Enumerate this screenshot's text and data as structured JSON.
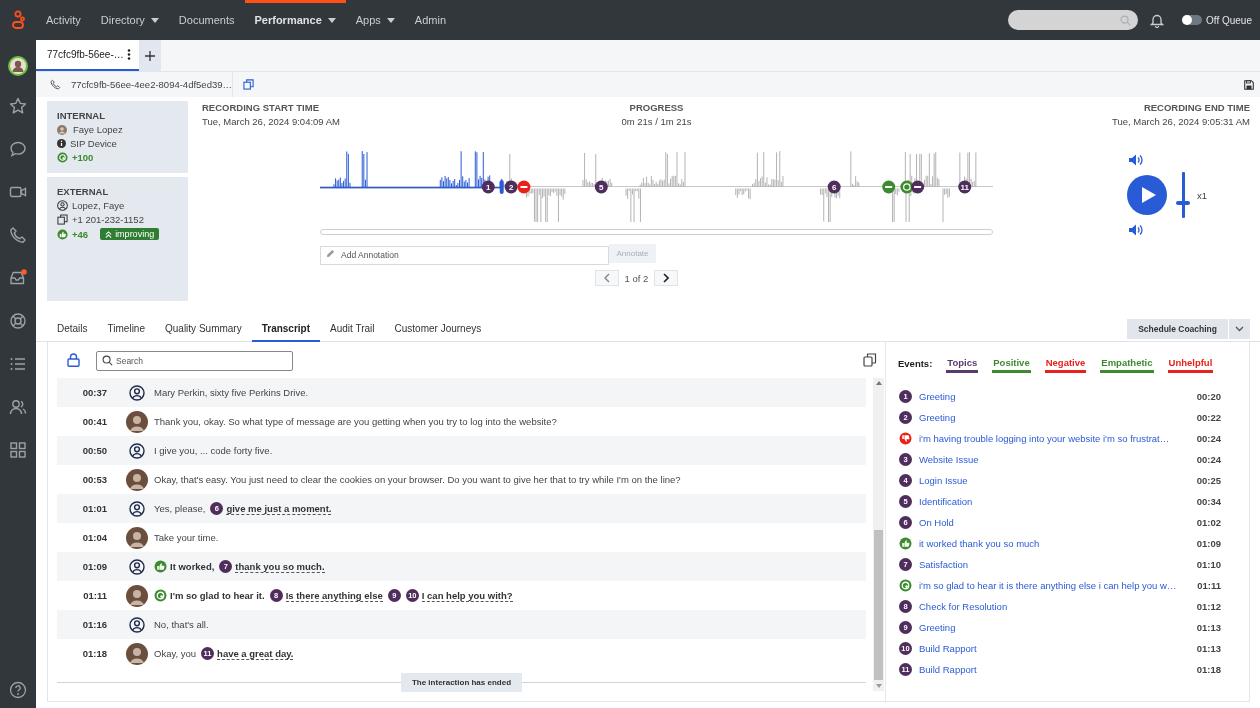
{
  "nav": {
    "items": [
      {
        "label": "Activity",
        "dropdown": false,
        "selected": false
      },
      {
        "label": "Directory",
        "dropdown": true,
        "selected": false
      },
      {
        "label": "Documents",
        "dropdown": false,
        "selected": false
      },
      {
        "label": "Performance",
        "dropdown": true,
        "selected": true
      },
      {
        "label": "Apps",
        "dropdown": true,
        "selected": false
      },
      {
        "label": "Admin",
        "dropdown": false,
        "selected": false
      }
    ],
    "queue": {
      "label": "Off Queue",
      "on": false
    }
  },
  "doc_tabs": [
    {
      "label": "77cfc9fb-56ee-…",
      "selected": true
    }
  ],
  "interaction_id": "77cfc9fb-56ee-4ee2-8094-4df5ed39…",
  "participants": [
    {
      "kind": "internal",
      "heading": "INTERNAL",
      "name": "Faye Lopez",
      "device": "SIP Device",
      "score": "+100"
    },
    {
      "kind": "external",
      "heading": "EXTERNAL",
      "name": "Lopez, Faye",
      "phone": "+1 201-232-1152",
      "score": "+46",
      "trend": "improving"
    }
  ],
  "recording": {
    "start_label": "RECORDING START TIME",
    "start_time": "Tue, March 26, 2024 9:04:09 AM",
    "progress_label": "PROGRESS",
    "progress": "0m 21s / 1m 21s",
    "end_label": "RECORDING END TIME",
    "end_time": "Tue, March 26, 2024 9:05:31 AM",
    "playback": {
      "level": 0.27
    },
    "markers": [
      {
        "kind": "topic",
        "label": "1"
      },
      {
        "kind": "topic",
        "label": "2"
      },
      {
        "kind": "negative"
      },
      {
        "kind": "topic",
        "label": "5"
      },
      {
        "kind": "topic",
        "label": "6"
      },
      {
        "kind": "positive"
      },
      {
        "kind": "empathetic"
      },
      {
        "kind": "group"
      },
      {
        "kind": "topic",
        "label": "11"
      }
    ],
    "volume": {
      "level": 0.35
    },
    "speed": "x1",
    "annotation": {
      "placeholder": "Add Annotation"
    },
    "annotate_button": {
      "label": "Annotate",
      "disabled": true
    },
    "pager": "1 of 2"
  },
  "detail_tabs": [
    {
      "label": "Details",
      "selected": false
    },
    {
      "label": "Timeline",
      "selected": false
    },
    {
      "label": "Quality Summary",
      "selected": false
    },
    {
      "label": "Transcript",
      "selected": true
    },
    {
      "label": "Audit Trail",
      "selected": false
    },
    {
      "label": "Customer Journeys",
      "selected": false
    }
  ],
  "schedule_button": "Schedule Coaching",
  "transcript": {
    "search": {
      "placeholder": "Search"
    },
    "rows": [
      {
        "time": "00:37",
        "kind": "customer",
        "parts": [
          {
            "kind": "plain",
            "text": "Mary Perkin, sixty five Perkins Drive."
          }
        ]
      },
      {
        "time": "00:41",
        "kind": "agent",
        "parts": [
          {
            "kind": "plain",
            "text": "Thank you, okay. So what type of message are you getting when you try to log into the website?"
          }
        ]
      },
      {
        "time": "00:50",
        "kind": "customer",
        "parts": [
          {
            "kind": "plain",
            "text": "I give you, ... code forty five."
          }
        ]
      },
      {
        "time": "00:53",
        "kind": "agent",
        "parts": [
          {
            "kind": "plain",
            "text": "Okay, that's easy. You just need to clear the cookies on your browser. Do you want to give her that to try while I'm on the line?"
          }
        ]
      },
      {
        "time": "01:01",
        "kind": "customer",
        "parts": [
          {
            "kind": "plain",
            "text": "Yes, please,"
          },
          {
            "kind": "topic",
            "marker": "6",
            "text": "give me just a moment."
          }
        ]
      },
      {
        "time": "01:04",
        "kind": "agent",
        "parts": [
          {
            "kind": "plain",
            "text": "Take your time."
          }
        ]
      },
      {
        "time": "01:09",
        "kind": "customer",
        "parts": [
          {
            "kind": "positive",
            "text": "It worked,"
          },
          {
            "kind": "topic",
            "marker": "7",
            "text": "thank you so much."
          }
        ]
      },
      {
        "time": "01:11",
        "kind": "agent",
        "parts": [
          {
            "kind": "empathetic",
            "text": "I'm so glad to hear it."
          },
          {
            "kind": "topic",
            "marker": "8",
            "text": "Is there anything else"
          },
          {
            "kind": "topic",
            "marker": "9"
          },
          {
            "kind": "topic",
            "marker": "10",
            "text": "I can help you with?"
          }
        ]
      },
      {
        "time": "01:16",
        "kind": "customer",
        "parts": [
          {
            "kind": "plain",
            "text": "No, that's all."
          }
        ]
      },
      {
        "time": "01:18",
        "kind": "agent",
        "parts": [
          {
            "kind": "plain",
            "text": "Okay, you"
          },
          {
            "kind": "topic",
            "marker": "11",
            "text": "have a great day."
          }
        ]
      }
    ],
    "end_note": "The interaction has ended"
  },
  "events": {
    "title": "Events:",
    "filters": [
      {
        "label": "Topics",
        "color": "#5b3a6b"
      },
      {
        "label": "Positive",
        "color": "#3d8b2f"
      },
      {
        "label": "Negative",
        "color": "#e8211b"
      },
      {
        "label": "Empathetic",
        "color": "#3d8b2f"
      },
      {
        "label": "Unhelpful",
        "color": "#e8211b"
      }
    ],
    "items": [
      {
        "kind": "topic",
        "number": "1",
        "label": "Greeting",
        "time": "00:20"
      },
      {
        "kind": "topic",
        "number": "2",
        "label": "Greeting",
        "time": "00:22"
      },
      {
        "kind": "negative",
        "label": "i'm having trouble logging into your website i'm so frustrat…",
        "time": "00:24"
      },
      {
        "kind": "topic",
        "number": "3",
        "label": "Website Issue",
        "time": "00:24"
      },
      {
        "kind": "topic",
        "number": "4",
        "label": "Login Issue",
        "time": "00:25"
      },
      {
        "kind": "topic",
        "number": "5",
        "label": "Identification",
        "time": "00:34"
      },
      {
        "kind": "topic",
        "number": "6",
        "label": "On Hold",
        "time": "01:02"
      },
      {
        "kind": "positive",
        "label": "it worked thank you so much",
        "time": "01:09"
      },
      {
        "kind": "topic",
        "number": "7",
        "label": "Satisfaction",
        "time": "01:10"
      },
      {
        "kind": "empathetic",
        "label": "i'm so glad to hear it is there anything else i can help you w…",
        "time": "01:11"
      },
      {
        "kind": "topic",
        "number": "8",
        "label": "Check for Resolution",
        "time": "01:12"
      },
      {
        "kind": "topic",
        "number": "9",
        "label": "Greeting",
        "time": "01:13"
      },
      {
        "kind": "topic",
        "number": "10",
        "label": "Build Rapport",
        "time": "01:13"
      },
      {
        "kind": "topic",
        "number": "11",
        "label": "Build Rapport",
        "time": "01:18"
      }
    ]
  }
}
